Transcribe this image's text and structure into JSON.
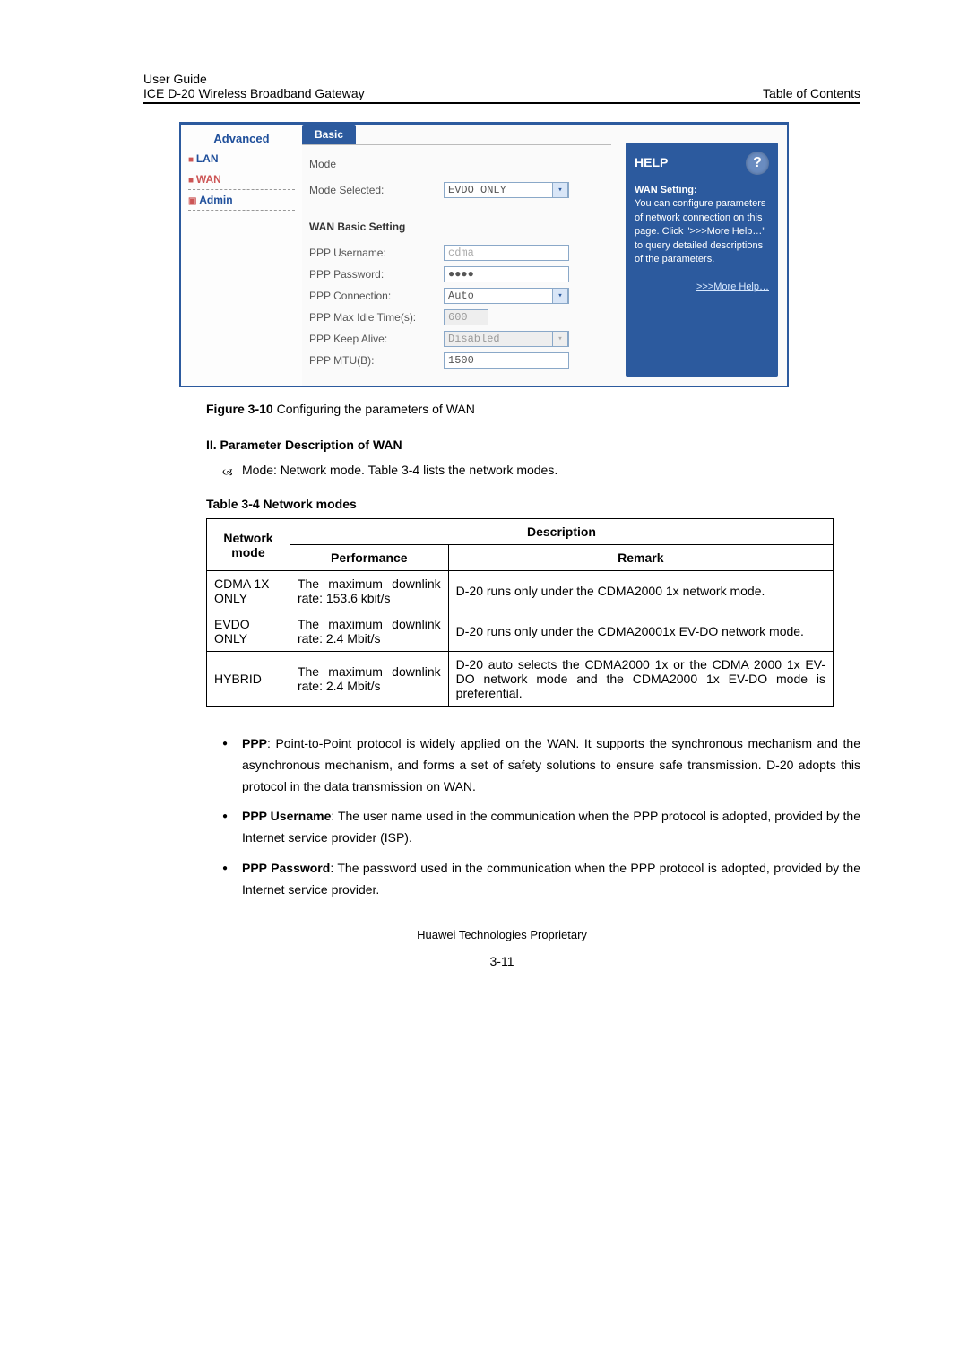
{
  "doc": {
    "header_line1": "User Guide",
    "header_line2_left": "ICE D-20 Wireless Broadband Gateway",
    "header_line2_right": "Table of Contents"
  },
  "sidebar": {
    "title": "Advanced",
    "lan": "LAN",
    "wan": "WAN",
    "admin": "Admin"
  },
  "tab": {
    "basic": "Basic"
  },
  "cfg": {
    "mode_section": "Mode",
    "mode_selected_lbl": "Mode Selected:",
    "mode_selected_val": "EVDO ONLY",
    "wan_section": "WAN Basic Setting",
    "ppp_user_lbl": "PPP Username:",
    "ppp_user_val": "cdma",
    "ppp_pass_lbl": "PPP Password:",
    "ppp_pass_val": "●●●●",
    "ppp_conn_lbl": "PPP Connection:",
    "ppp_conn_val": "Auto",
    "ppp_idle_lbl": "PPP Max Idle Time(s):",
    "ppp_idle_val": "600",
    "ppp_keep_lbl": "PPP Keep Alive:",
    "ppp_keep_val": "Disabled",
    "ppp_mtu_lbl": "PPP MTU(B):",
    "ppp_mtu_val": "1500"
  },
  "help": {
    "title": "HELP",
    "bold": "WAN Setting:",
    "text": "You can configure parameters of network connection on this page. Click \">>>More Help…\" to query detailed descriptions of the parameters.",
    "more": ">>>More Help…"
  },
  "figure": {
    "bold": "Figure 3-10",
    "rest": " Configuring the parameters of WAN"
  },
  "sectionII": "II. Parameter Description of WAN",
  "bullet_mode": "Mode: Network mode. Table 3-4 lists the network modes.",
  "table_caption": {
    "bold": "Table 3-4",
    "rest": " Network modes"
  },
  "chart_data": {
    "type": "table",
    "columns": [
      "Network mode",
      "Performance",
      "Remark"
    ],
    "description_header": "Description",
    "rows": [
      {
        "mode": "CDMA 1X ONLY",
        "perf": "The maximum downlink rate: 153.6 kbit/s",
        "remark": "D-20 runs only under the CDMA2000 1x network mode."
      },
      {
        "mode": "EVDO ONLY",
        "perf": "The maximum downlink rate: 2.4 Mbit/s",
        "remark": "D-20 runs only under the CDMA20001x EV-DO network mode."
      },
      {
        "mode": "HYBRID",
        "perf": "The maximum downlink rate: 2.4 Mbit/s",
        "remark": "D-20 auto selects the CDMA2000 1x or the CDMA 2000 1x EV-DO network mode and the CDMA2000 1x EV-DO mode is preferential."
      }
    ]
  },
  "bullets": {
    "ppp_b": "PPP",
    "ppp": ": Point-to-Point protocol is widely applied on the WAN. It supports the synchronous mechanism and the asynchronous mechanism, and forms a set of safety solutions to ensure safe transmission. D-20 adopts this protocol in the data transmission on WAN.",
    "user_b": "PPP Username",
    "user": ": The user name used in the communication when the PPP protocol is adopted, provided by the Internet service provider (ISP).",
    "pass_b": "PPP Password",
    "pass": ": The password used in the communication when the PPP protocol is adopted, provided by the Internet service provider."
  },
  "footer": "Huawei Technologies Proprietary",
  "page_num": "3-11"
}
